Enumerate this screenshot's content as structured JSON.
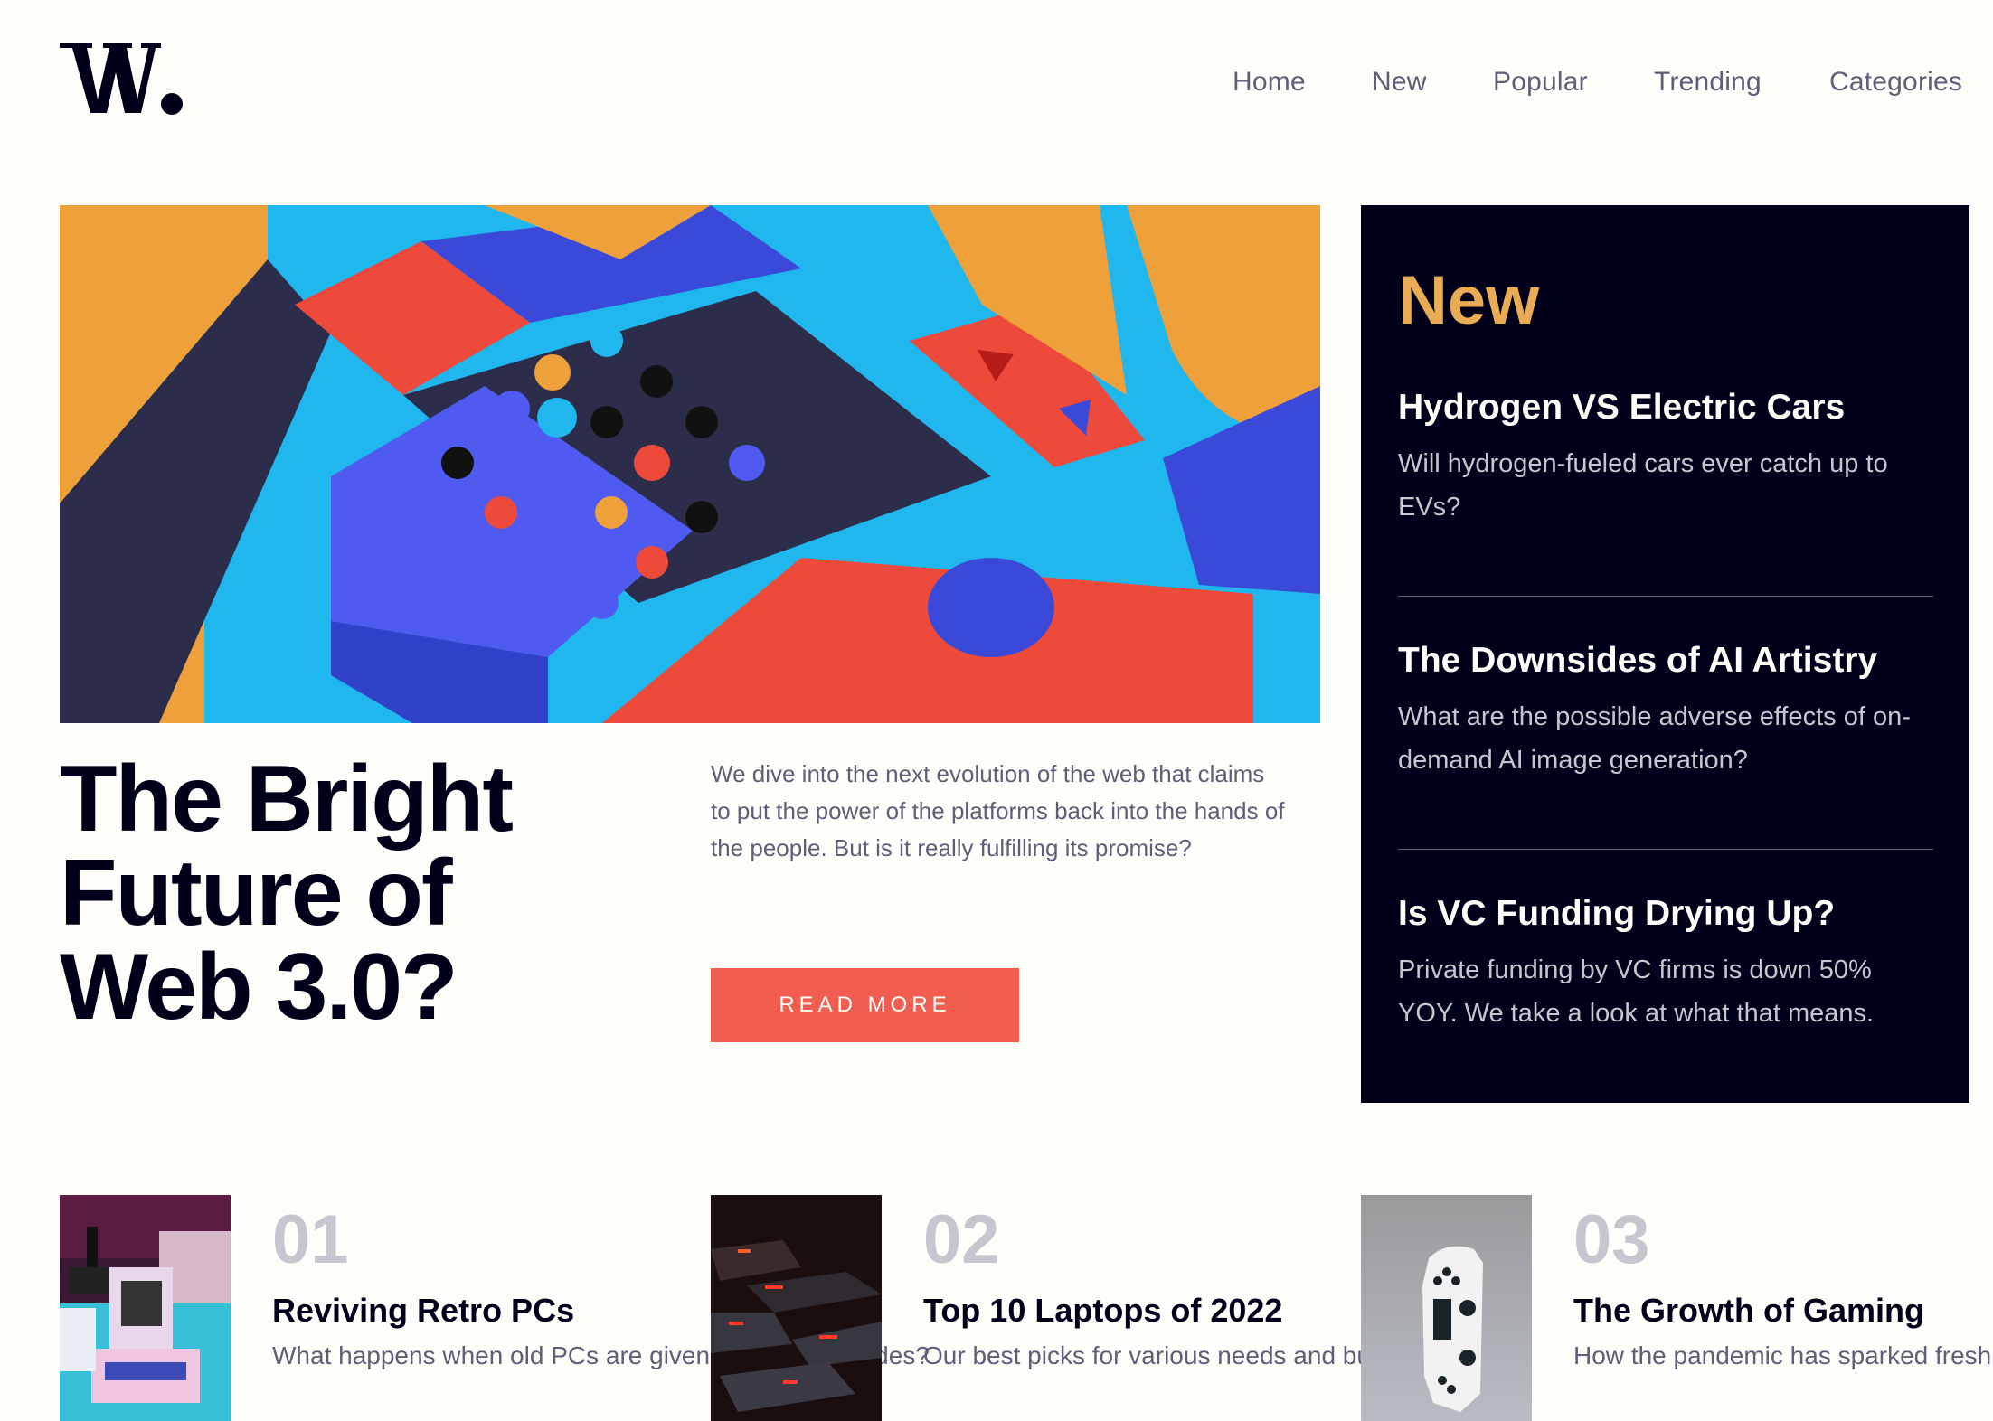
{
  "brand": {
    "logo_text": "W.",
    "logo_icon": "w-logo-icon"
  },
  "nav": {
    "items": [
      {
        "label": "Home"
      },
      {
        "label": "New"
      },
      {
        "label": "Popular"
      },
      {
        "label": "Trending"
      },
      {
        "label": "Categories"
      }
    ]
  },
  "hero": {
    "image_alt": "Colorful 3D geometric wooden blocks",
    "title": "The Bright Future of Web 3.0?",
    "description": "We dive into the next evolution of the web that claims to put the power of the platforms back into the hands of the people. But is it really fulfilling its promise?",
    "button_label": "READ MORE"
  },
  "new_panel": {
    "heading": "New",
    "items": [
      {
        "title": "Hydrogen VS Electric Cars",
        "description": "Will hydrogen-fueled cars ever catch up to EVs?"
      },
      {
        "title": "The Downsides of AI Artistry",
        "description": "What are the possible adverse effects of on-demand AI image generation?"
      },
      {
        "title": "Is VC Funding Drying Up?",
        "description": "Private funding by VC firms is down 50% YOY. We take a look at what that means."
      }
    ]
  },
  "cards": [
    {
      "number": "01",
      "title": "Reviving Retro PCs",
      "description": "What happens when old PCs are given modern upgrades?",
      "image_alt": "Retro computers"
    },
    {
      "number": "02",
      "title": "Top 10 Laptops of 2022",
      "description": "Our best picks for various needs and budgets.",
      "image_alt": "Backlit laptop keyboard"
    },
    {
      "number": "03",
      "title": "The Growth of Gaming",
      "description": "How the pandemic has sparked fresh opportunities.",
      "image_alt": "White game controller"
    }
  ],
  "colors": {
    "background": "#fffdfa",
    "dark": "#00001a",
    "accent_red": "#f15e50",
    "accent_orange": "#e9ab53",
    "text_muted": "#5d5f79",
    "text_light": "#c5c6ce"
  }
}
